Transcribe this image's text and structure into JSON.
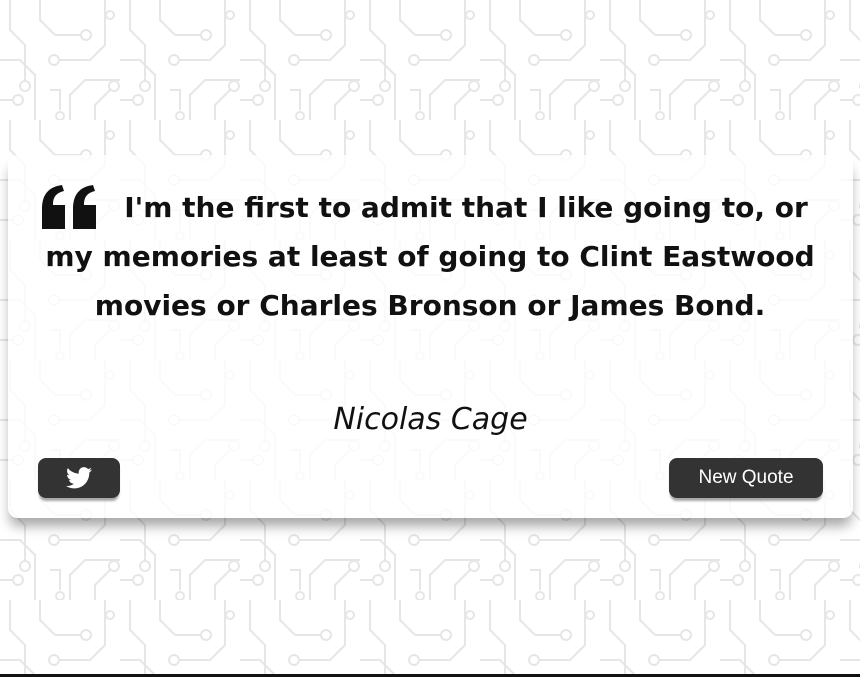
{
  "quote": {
    "text": "I'm the first to admit that I like going to, or my memories at least of going to Clint Eastwood movies or Charles Bronson or James Bond.",
    "author": "Nicolas Cage",
    "quote_icon": "quote-left-icon"
  },
  "buttons": {
    "tweet_icon": "twitter-icon",
    "new_quote_label": "New Quote"
  },
  "colors": {
    "background": "#ffffff",
    "pattern": "#e6e6e6",
    "card": "#ffffff",
    "button": "#333333",
    "button_text": "#ffffff",
    "text": "#111111"
  }
}
